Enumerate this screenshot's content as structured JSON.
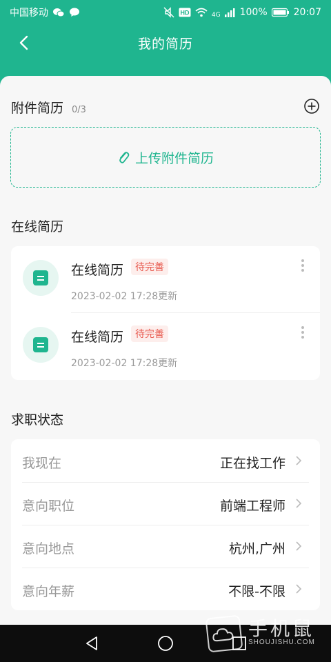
{
  "status_bar": {
    "carrier": "中国移动",
    "signal_label": "4G",
    "battery": "100%",
    "time": "20:07"
  },
  "navbar": {
    "title": "我的简历"
  },
  "attachments": {
    "title": "附件简历",
    "count": "0/3",
    "upload_label": "上传附件简历"
  },
  "online": {
    "title": "在线简历",
    "items": [
      {
        "name": "在线简历",
        "badge": "待完善",
        "updated": "2023-02-02 17:28更新"
      },
      {
        "name": "在线简历",
        "badge": "待完善",
        "updated": "2023-02-02 17:28更新"
      }
    ]
  },
  "job_status": {
    "title": "求职状态",
    "rows": [
      {
        "label": "我现在",
        "value": "正在找工作"
      },
      {
        "label": "意向职位",
        "value": "前端工程师"
      },
      {
        "label": "意向地点",
        "value": "杭州,广州"
      },
      {
        "label": "意向年薪",
        "value": "不限-不限"
      }
    ]
  },
  "watermark": {
    "cn": "手机鼠",
    "en": "SHOUJISHU.COM"
  },
  "colors": {
    "accent": "#1fb58f",
    "badge_text": "#e85a4f",
    "badge_bg": "#fdeeec",
    "background": "#f7f7f7"
  }
}
